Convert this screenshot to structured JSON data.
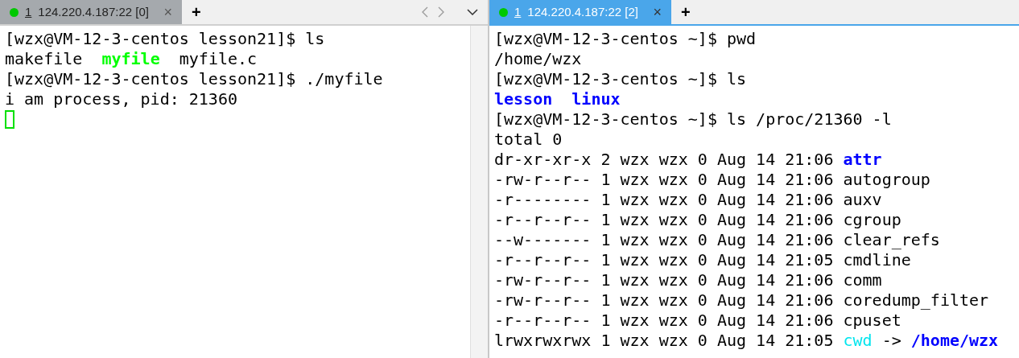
{
  "panes": [
    {
      "active": false,
      "tab": {
        "number": "1",
        "label": "124.220.4.187:22 [0]",
        "close": "×"
      },
      "new_tab": "+",
      "cursor": true,
      "lines": [
        [
          {
            "text": "[wzx@VM-12-3-centos lesson21]$ ls",
            "kind": "plain"
          }
        ],
        [
          {
            "text": "makefile  ",
            "kind": "plain"
          },
          {
            "text": "myfile",
            "kind": "exec"
          },
          {
            "text": "  myfile.c",
            "kind": "plain"
          }
        ],
        [
          {
            "text": "[wzx@VM-12-3-centos lesson21]$ ./myfile",
            "kind": "plain"
          }
        ],
        [
          {
            "text": "i am process, pid: 21360",
            "kind": "plain"
          }
        ]
      ]
    },
    {
      "active": true,
      "tab": {
        "number": "1",
        "label": "124.220.4.187:22 [2]",
        "close": "×"
      },
      "new_tab": "+",
      "cursor": false,
      "lines": [
        [
          {
            "text": "[wzx@VM-12-3-centos ~]$ pwd",
            "kind": "plain"
          }
        ],
        [
          {
            "text": "/home/wzx",
            "kind": "plain"
          }
        ],
        [
          {
            "text": "[wzx@VM-12-3-centos ~]$ ls",
            "kind": "plain"
          }
        ],
        [
          {
            "text": "lesson",
            "kind": "dir"
          },
          {
            "text": "  linux",
            "kind": "dir"
          }
        ],
        [
          {
            "text": "[wzx@VM-12-3-centos ~]$ ls /proc/21360 -l",
            "kind": "plain"
          }
        ],
        [
          {
            "text": "total 0",
            "kind": "plain"
          }
        ],
        [
          {
            "text": "dr-xr-xr-x 2 wzx wzx 0 Aug 14 21:06 ",
            "kind": "plain"
          },
          {
            "text": "attr",
            "kind": "dir"
          }
        ],
        [
          {
            "text": "-rw-r--r-- 1 wzx wzx 0 Aug 14 21:06 autogroup",
            "kind": "plain"
          }
        ],
        [
          {
            "text": "-r-------- 1 wzx wzx 0 Aug 14 21:06 auxv",
            "kind": "plain"
          }
        ],
        [
          {
            "text": "-r--r--r-- 1 wzx wzx 0 Aug 14 21:06 cgroup",
            "kind": "plain"
          }
        ],
        [
          {
            "text": "--w------- 1 wzx wzx 0 Aug 14 21:06 clear_refs",
            "kind": "plain"
          }
        ],
        [
          {
            "text": "-r--r--r-- 1 wzx wzx 0 Aug 14 21:05 cmdline",
            "kind": "plain"
          }
        ],
        [
          {
            "text": "-rw-r--r-- 1 wzx wzx 0 Aug 14 21:06 comm",
            "kind": "plain"
          }
        ],
        [
          {
            "text": "-rw-r--r-- 1 wzx wzx 0 Aug 14 21:06 coredump_filter",
            "kind": "plain"
          }
        ],
        [
          {
            "text": "-r--r--r-- 1 wzx wzx 0 Aug 14 21:06 cpuset",
            "kind": "plain"
          }
        ],
        [
          {
            "text": "lrwxrwxrwx 1 wzx wzx 0 Aug 14 21:05 ",
            "kind": "plain"
          },
          {
            "text": "cwd",
            "kind": "link"
          },
          {
            "text": " -> ",
            "kind": "plain"
          },
          {
            "text": "/home/wzx",
            "kind": "dir"
          }
        ]
      ]
    }
  ]
}
